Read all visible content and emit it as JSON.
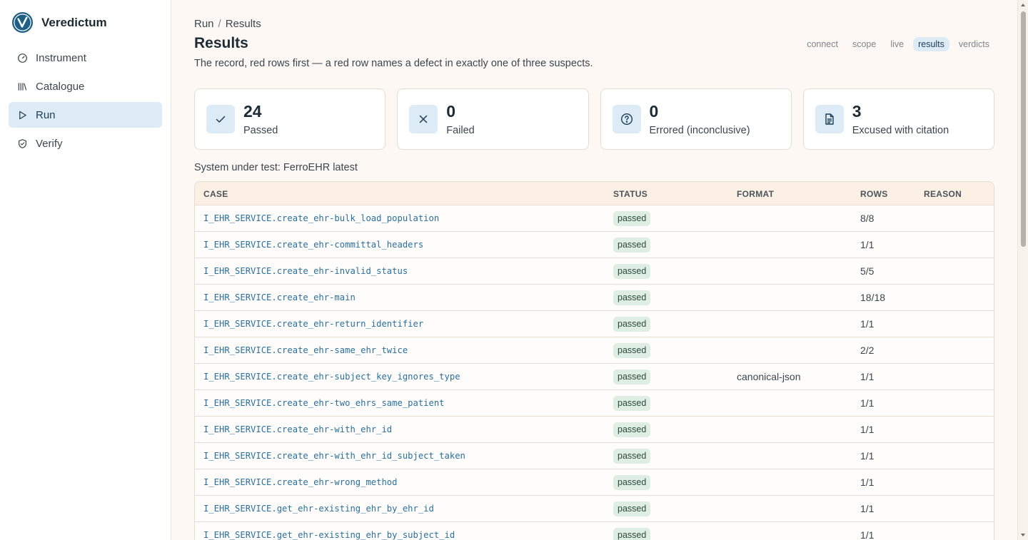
{
  "app": {
    "name": "Veredictum"
  },
  "sidebar": {
    "items": [
      {
        "label": "Instrument",
        "icon": "gauge-icon",
        "active": false
      },
      {
        "label": "Catalogue",
        "icon": "library-icon",
        "active": false
      },
      {
        "label": "Run",
        "icon": "play-icon",
        "active": true
      },
      {
        "label": "Verify",
        "icon": "shield-check-icon",
        "active": false
      }
    ]
  },
  "breadcrumb": {
    "parent": "Run",
    "separator": "/",
    "current": "Results"
  },
  "page": {
    "title": "Results",
    "subtitle": "The record, red rows first — a red row names a defect in exactly one of three suspects."
  },
  "steps": [
    {
      "label": "connect",
      "active": false
    },
    {
      "label": "scope",
      "active": false
    },
    {
      "label": "live",
      "active": false
    },
    {
      "label": "results",
      "active": true
    },
    {
      "label": "verdicts",
      "active": false
    }
  ],
  "summary": [
    {
      "value": "24",
      "label": "Passed",
      "icon": "check-icon"
    },
    {
      "value": "0",
      "label": "Failed",
      "icon": "x-icon"
    },
    {
      "value": "0",
      "label": "Errored (inconclusive)",
      "icon": "question-circle-icon"
    },
    {
      "value": "3",
      "label": "Excused with citation",
      "icon": "document-icon"
    }
  ],
  "system_under_test": "System under test: FerroEHR latest",
  "table": {
    "headers": {
      "case": "CASE",
      "status": "STATUS",
      "format": "FORMAT",
      "rows": "ROWS",
      "reason": "REASON"
    },
    "rows": [
      {
        "case": "I_EHR_SERVICE.create_ehr-bulk_load_population",
        "status": "passed",
        "format": "",
        "rows": "8/8",
        "reason": ""
      },
      {
        "case": "I_EHR_SERVICE.create_ehr-committal_headers",
        "status": "passed",
        "format": "",
        "rows": "1/1",
        "reason": ""
      },
      {
        "case": "I_EHR_SERVICE.create_ehr-invalid_status",
        "status": "passed",
        "format": "",
        "rows": "5/5",
        "reason": ""
      },
      {
        "case": "I_EHR_SERVICE.create_ehr-main",
        "status": "passed",
        "format": "",
        "rows": "18/18",
        "reason": ""
      },
      {
        "case": "I_EHR_SERVICE.create_ehr-return_identifier",
        "status": "passed",
        "format": "",
        "rows": "1/1",
        "reason": ""
      },
      {
        "case": "I_EHR_SERVICE.create_ehr-same_ehr_twice",
        "status": "passed",
        "format": "",
        "rows": "2/2",
        "reason": ""
      },
      {
        "case": "I_EHR_SERVICE.create_ehr-subject_key_ignores_type",
        "status": "passed",
        "format": "canonical-json",
        "rows": "1/1",
        "reason": ""
      },
      {
        "case": "I_EHR_SERVICE.create_ehr-two_ehrs_same_patient",
        "status": "passed",
        "format": "",
        "rows": "1/1",
        "reason": ""
      },
      {
        "case": "I_EHR_SERVICE.create_ehr-with_ehr_id",
        "status": "passed",
        "format": "",
        "rows": "1/1",
        "reason": ""
      },
      {
        "case": "I_EHR_SERVICE.create_ehr-with_ehr_id_subject_taken",
        "status": "passed",
        "format": "",
        "rows": "1/1",
        "reason": ""
      },
      {
        "case": "I_EHR_SERVICE.create_ehr-wrong_method",
        "status": "passed",
        "format": "",
        "rows": "1/1",
        "reason": ""
      },
      {
        "case": "I_EHR_SERVICE.get_ehr-existing_ehr_by_ehr_id",
        "status": "passed",
        "format": "",
        "rows": "1/1",
        "reason": ""
      },
      {
        "case": "I_EHR_SERVICE.get_ehr-existing_ehr_by_subject_id",
        "status": "passed",
        "format": "",
        "rows": "1/1",
        "reason": ""
      }
    ]
  },
  "colors": {
    "accent": "#2a6f9e",
    "logo": "#1f5f86",
    "active_bg": "#dcebf6",
    "passed_bg": "#dfeee3",
    "page_bg": "#fdf8f3"
  }
}
